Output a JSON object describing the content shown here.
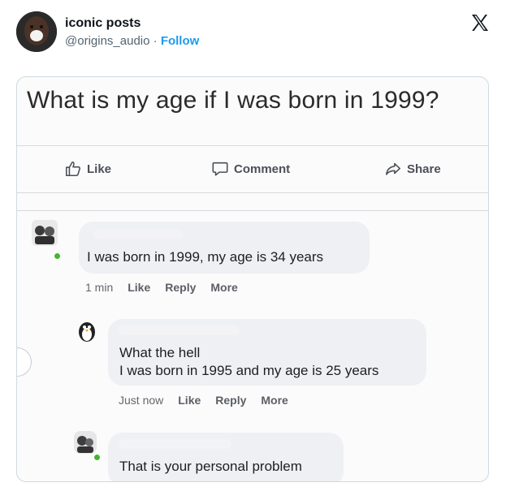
{
  "tweet": {
    "author_name": "iconic posts",
    "handle": "@origins_audio",
    "separator": "·",
    "follow_label": "Follow"
  },
  "post": {
    "question": "What is my age if I was born in 1999?",
    "actions": {
      "like": "Like",
      "comment": "Comment",
      "share": "Share"
    }
  },
  "comments": [
    {
      "text": "I was born in 1999, my age is 34 years",
      "time": "1 min",
      "like": "Like",
      "reply": "Reply",
      "more": "More"
    },
    {
      "text_line1": "What the hell",
      "text_line2": "I was born in 1995 and my age is 25 years",
      "time": "Just now",
      "like": "Like",
      "reply": "Reply",
      "more": "More"
    },
    {
      "text": "That is your personal problem"
    }
  ],
  "colors": {
    "link_blue": "#1d9bf0",
    "online_green": "#42b72a",
    "bubble_gray": "#eff0f3"
  },
  "icons": [
    "x-logo-icon",
    "like-thumb-icon",
    "comment-bubble-icon",
    "share-arrow-icon"
  ]
}
